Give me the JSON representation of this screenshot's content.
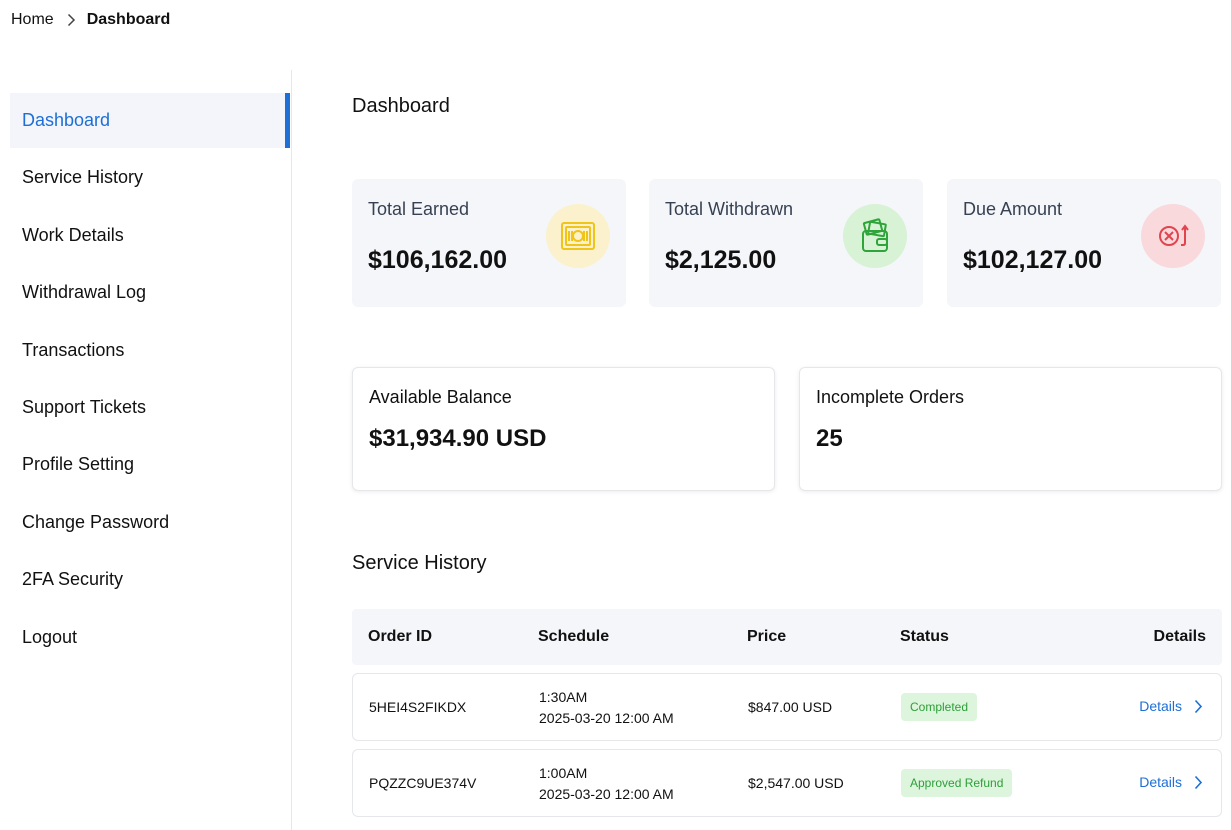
{
  "breadcrumb": {
    "home": "Home",
    "current": "Dashboard"
  },
  "sidebar": {
    "items": [
      {
        "label": "Dashboard",
        "active": true
      },
      {
        "label": "Service History"
      },
      {
        "label": "Work Details"
      },
      {
        "label": "Withdrawal Log"
      },
      {
        "label": "Transactions"
      },
      {
        "label": "Support Tickets"
      },
      {
        "label": "Profile Setting"
      },
      {
        "label": "Change Password"
      },
      {
        "label": "2FA Security"
      },
      {
        "label": "Logout"
      }
    ]
  },
  "main": {
    "title": "Dashboard",
    "stats": [
      {
        "label": "Total Earned",
        "value": "$106,162.00",
        "icon": "cash-icon",
        "icon_color": "#f0c419",
        "icon_bg": "#fbf1cc"
      },
      {
        "label": "Total Withdrawn",
        "value": "$2,125.00",
        "icon": "wallet-icon",
        "icon_color": "#2fa43a",
        "icon_bg": "#d8f2d6"
      },
      {
        "label": "Due Amount",
        "value": "$102,127.00",
        "icon": "due-icon",
        "icon_color": "#e0454f",
        "icon_bg": "#f9d9dc"
      }
    ],
    "balance": {
      "label": "Available Balance",
      "value": "$31,934.90 USD"
    },
    "incomplete": {
      "label": "Incomplete Orders",
      "value": "25"
    },
    "service_history": {
      "title": "Service History",
      "columns": [
        "Order ID",
        "Schedule",
        "Price",
        "Status",
        "Details"
      ],
      "rows": [
        {
          "order_id": "5HEI4S2FIKDX",
          "time": "1:30AM",
          "date": "2025-03-20 12:00 AM",
          "price": "$847.00 USD",
          "status": "Completed",
          "details": "Details"
        },
        {
          "order_id": "PQZZC9UE374V",
          "time": "1:00AM",
          "date": "2025-03-20 12:00 AM",
          "price": "$2,547.00 USD",
          "status": "Approved Refund",
          "details": "Details"
        }
      ]
    }
  },
  "colors": {
    "accent": "#1d6fd6",
    "success_bg": "#dcf5dc",
    "success_text": "#2f9e3a"
  }
}
